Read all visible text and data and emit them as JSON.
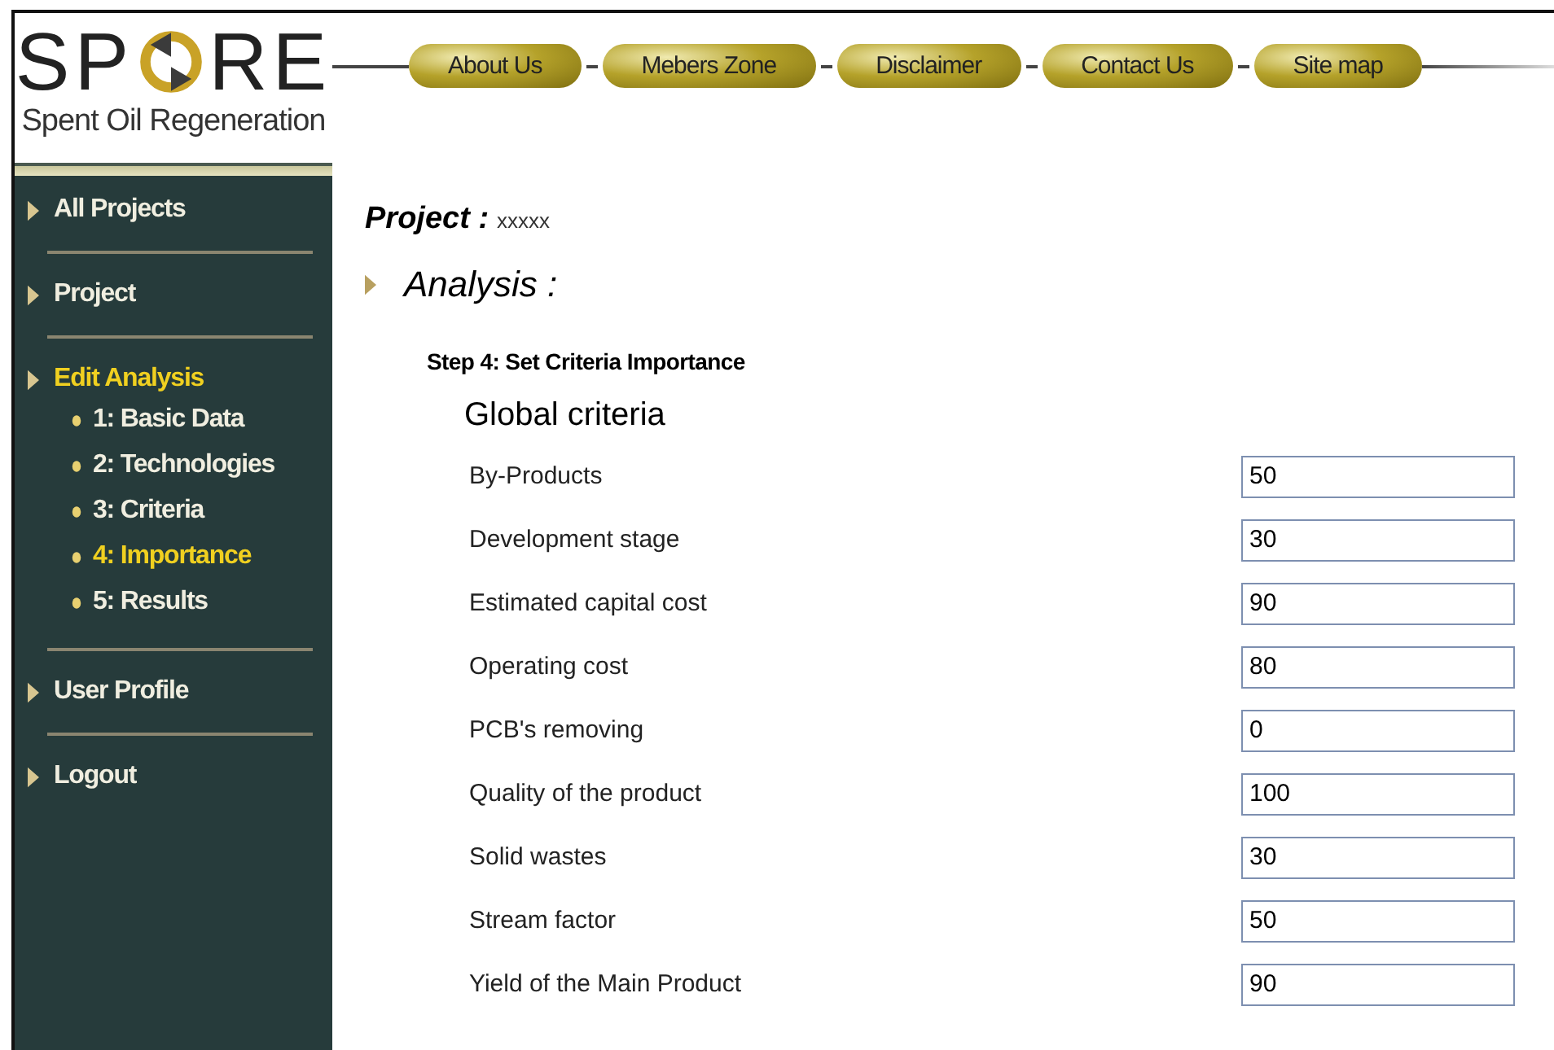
{
  "logo": {
    "left": "SP",
    "right": "RE",
    "tagline": "Spent Oil Regeneration"
  },
  "top_nav": [
    {
      "label": "About Us"
    },
    {
      "label": "Mebers Zone"
    },
    {
      "label": "Disclaimer"
    },
    {
      "label": "Contact Us"
    },
    {
      "label": "Site map"
    }
  ],
  "sidebar": {
    "items": [
      {
        "label": "All Projects",
        "selected": false
      },
      {
        "label": "Project",
        "selected": false
      },
      {
        "label": "Edit Analysis",
        "selected": true,
        "children": [
          {
            "label": "1: Basic Data",
            "selected": false
          },
          {
            "label": "2: Technologies",
            "selected": false
          },
          {
            "label": "3: Criteria",
            "selected": false
          },
          {
            "label": "4: Importance",
            "selected": true
          },
          {
            "label": "5: Results",
            "selected": false
          }
        ]
      },
      {
        "label": "User Profile",
        "selected": false
      },
      {
        "label": "Logout",
        "selected": false
      }
    ]
  },
  "project": {
    "label": "Project :",
    "value": "xxxxx"
  },
  "section": "Analysis :",
  "step": "Step 4: Set Criteria Importance",
  "group_title": "Global criteria",
  "criteria": [
    {
      "label": "By-Products",
      "value": "50"
    },
    {
      "label": "Development stage",
      "value": "30"
    },
    {
      "label": "Estimated capital cost",
      "value": "90"
    },
    {
      "label": "Operating cost",
      "value": "80"
    },
    {
      "label": "PCB's removing",
      "value": "0"
    },
    {
      "label": "Quality of the product",
      "value": "100"
    },
    {
      "label": "Solid wastes",
      "value": "30"
    },
    {
      "label": "Stream factor",
      "value": "50"
    },
    {
      "label": "Yield of the Main Product",
      "value": "90"
    }
  ]
}
